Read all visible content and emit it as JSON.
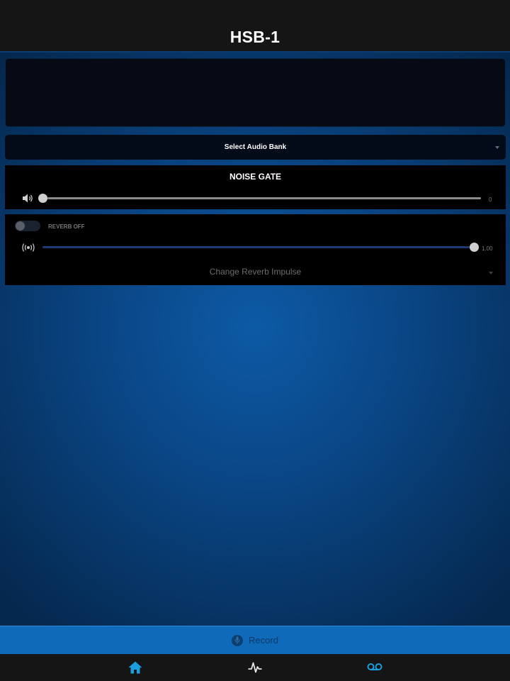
{
  "header": {
    "title": "HSB-1"
  },
  "audio_bank_select": {
    "label": "Select Audio Bank"
  },
  "noise_gate": {
    "title": "NOISE GATE",
    "value": "0",
    "level": 0
  },
  "reverb": {
    "toggle_label": "REVERB OFF",
    "enabled": false,
    "value": "1.00",
    "level": 1.0,
    "impulse_select_label": "Change Reverb Impulse"
  },
  "record": {
    "label": "Record"
  },
  "tabs": [
    {
      "icon": "home-icon",
      "active": true
    },
    {
      "icon": "pulse-icon",
      "active": false
    },
    {
      "icon": "voicemail-icon",
      "active": false
    }
  ],
  "colors": {
    "accent": "#1a9ee0",
    "record_bar": "#0f6bba",
    "header_bg": "#151515"
  }
}
